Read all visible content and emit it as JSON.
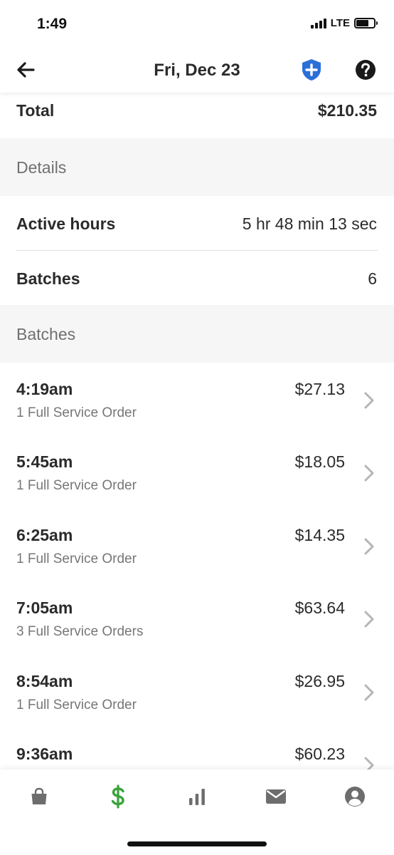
{
  "status_bar": {
    "time": "1:49",
    "network": "LTE"
  },
  "header": {
    "title": "Fri, Dec 23",
    "back_icon": "arrow-left-icon",
    "shield_icon": "shield-plus-icon",
    "help_icon": "help-circle-icon"
  },
  "summary": {
    "total_label": "Total",
    "total_value": "$210.35"
  },
  "details": {
    "section_title": "Details",
    "active_hours_label": "Active hours",
    "active_hours_value": "5 hr 48 min 13 sec",
    "batches_label": "Batches",
    "batches_value": "6"
  },
  "batches": {
    "section_title": "Batches",
    "items": [
      {
        "time": "4:19am",
        "orders": "1 Full Service Order",
        "amount": "$27.13"
      },
      {
        "time": "5:45am",
        "orders": "1 Full Service Order",
        "amount": "$18.05"
      },
      {
        "time": "6:25am",
        "orders": "1 Full Service Order",
        "amount": "$14.35"
      },
      {
        "time": "7:05am",
        "orders": "3 Full Service Orders",
        "amount": "$63.64"
      },
      {
        "time": "8:54am",
        "orders": "1 Full Service Order",
        "amount": "$26.95"
      },
      {
        "time": "9:36am",
        "orders": "",
        "amount": "$60.23"
      }
    ]
  },
  "tab_bar": {
    "tabs": [
      {
        "icon": "shopping-bag-icon",
        "active": false
      },
      {
        "icon": "dollar-sign-icon",
        "active": true
      },
      {
        "icon": "bar-chart-icon",
        "active": false
      },
      {
        "icon": "mail-icon",
        "active": false
      },
      {
        "icon": "account-icon",
        "active": false
      }
    ]
  },
  "colors": {
    "accent_blue": "#2b6fd8",
    "active_green": "#3aa33a",
    "inactive_icon": "#6d6d6d",
    "section_bg": "#f6f6f6"
  }
}
